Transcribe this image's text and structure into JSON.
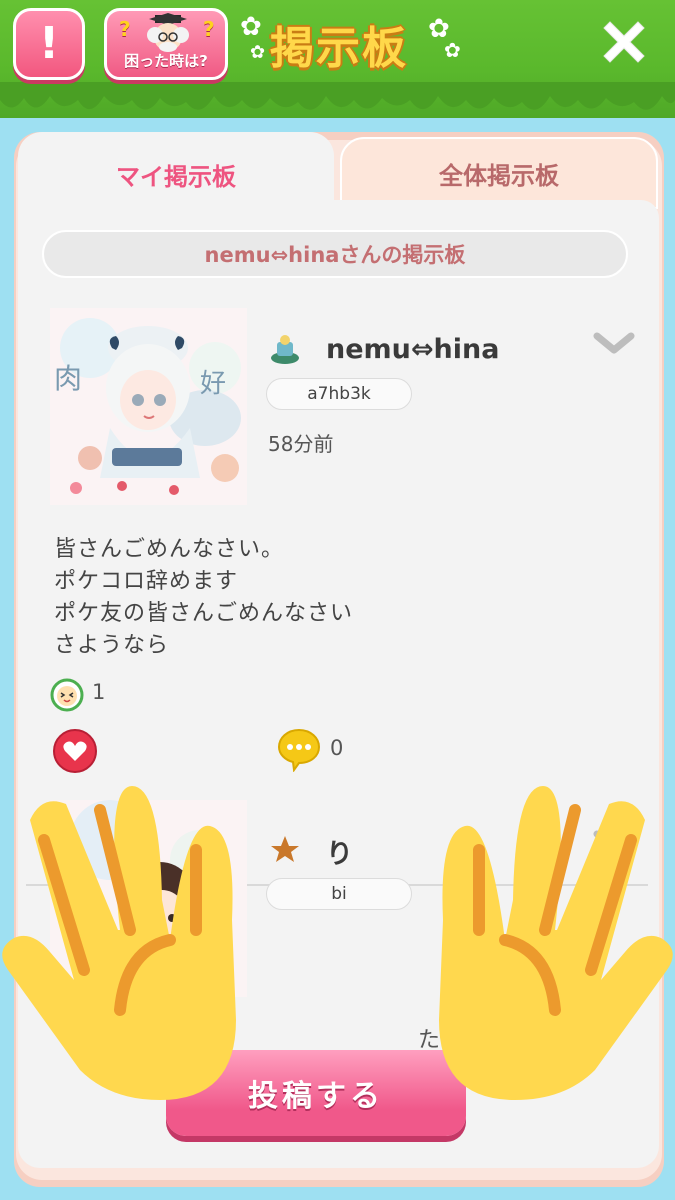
{
  "header": {
    "alert_label": "!",
    "help_label": "困った時は?",
    "help_marks": "?",
    "title": "掲示板",
    "close_icon": "close-icon"
  },
  "tabs": [
    {
      "label": "マイ掲示板",
      "active": true
    },
    {
      "label": "全体掲示板",
      "active": false
    }
  ],
  "board": {
    "title": "nemu⇔hinaさんの掲示板"
  },
  "posts": [
    {
      "user_name": "nemu⇔hina",
      "user_id": "a7hb3k",
      "time": "58分前",
      "body": [
        "皆さんごめんなさい。",
        "ポケコロ辞めます",
        "ポケ友の皆さんごめんなさい",
        "さようなら"
      ],
      "reactions": "1",
      "comments": "0"
    },
    {
      "user_name": "り",
      "user_id": "bi",
      "partial_text": "たてさん？"
    }
  ],
  "post_button": "投稿する",
  "colors": {
    "accent_pink": "#ee5480",
    "header_green": "#5ab82c",
    "sky": "#9ee0f2",
    "title_gold": "#ffd84a"
  }
}
